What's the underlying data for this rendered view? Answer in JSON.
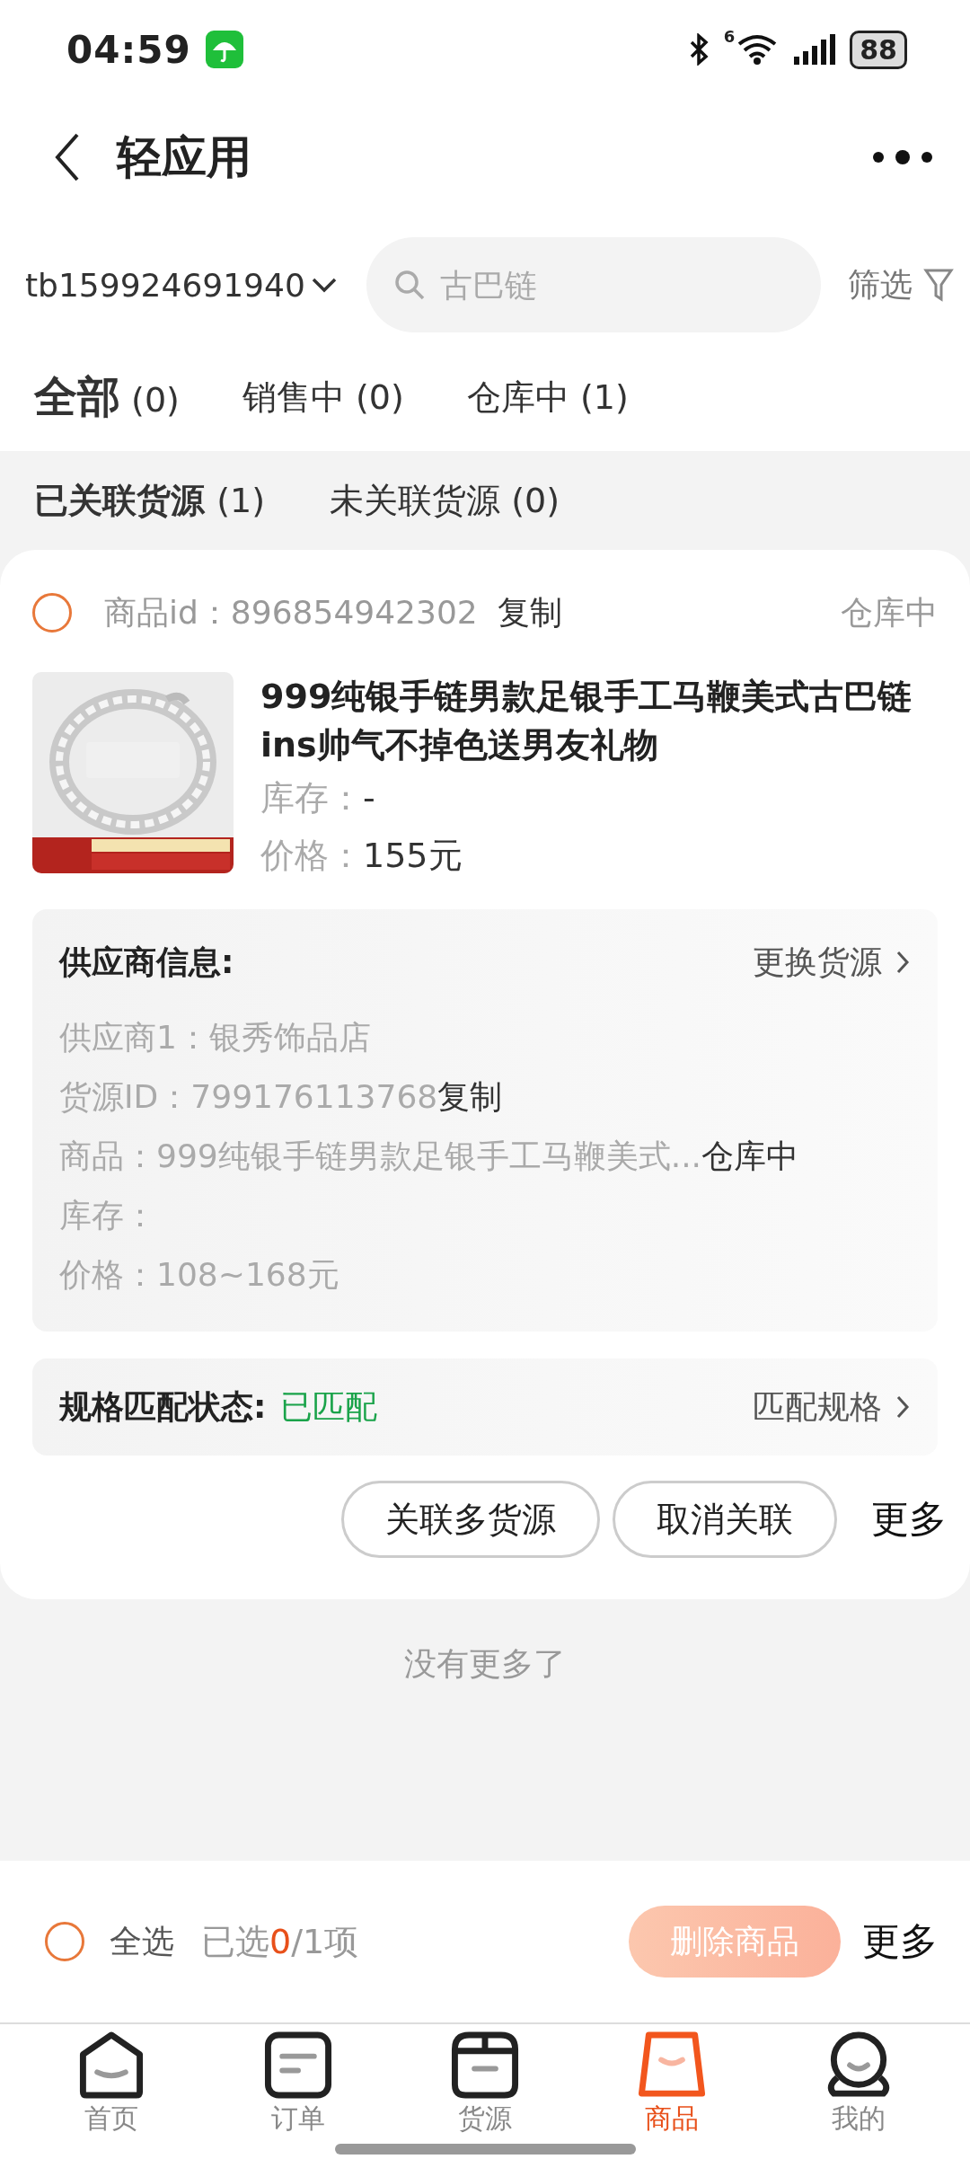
{
  "status_bar": {
    "time": "04:59",
    "battery": "88",
    "network": "6"
  },
  "header": {
    "title": "轻应用"
  },
  "account": {
    "name": "tb159924691940"
  },
  "search": {
    "placeholder": "古巴链"
  },
  "filter": {
    "label": "筛选"
  },
  "tabs": [
    {
      "label": "全部",
      "count": "(0)",
      "selected": true
    },
    {
      "label": "销售中",
      "count": "(0)",
      "selected": false
    },
    {
      "label": "仓库中",
      "count": "(1)",
      "selected": false
    }
  ],
  "sub_tabs": [
    {
      "label": "已关联货源",
      "count": "(1)",
      "selected": true
    },
    {
      "label": "未关联货源",
      "count": "(0)",
      "selected": false
    }
  ],
  "products": [
    {
      "checked": false,
      "id_label": "商品id：",
      "id": "896854942302",
      "copy": "复制",
      "status": "仓库中",
      "image": {
        "kind": "picture"
      },
      "title": "999纯银手链男款足银手工马鞭美式古巴链ins帅气不掉色送男友礼物",
      "stock_label": "库存：",
      "stock": "-",
      "price_label": "价格：",
      "price": "155元",
      "supplier": {
        "heading": "供应商信息:",
        "change": "更换货源",
        "lines": [
          {
            "text": "供应商1：银秀饰品店"
          },
          {
            "text": "货源ID：799176113768",
            "action": "复制"
          },
          {
            "text": "商品：999纯银手链男款足银手工马鞭美式...",
            "action": "仓库中"
          },
          {
            "text": "库存："
          },
          {
            "text": "价格：108~168元"
          }
        ]
      },
      "spec": {
        "label": "规格匹配状态:",
        "value": "已匹配",
        "action": "匹配规格"
      },
      "actions": [
        "关联多货源",
        "取消关联"
      ],
      "more": "更多"
    }
  ],
  "end_note": "没有更多了",
  "footer": {
    "select_all": {
      "label": "全选",
      "checked": false
    },
    "selected_prefix": "已选",
    "selected_count": "0",
    "selected_total": "/1项",
    "delete_button": {
      "label": "删除商品",
      "disabled": true
    },
    "more": "更多"
  },
  "nav": [
    {
      "kind": "home",
      "label": "首页",
      "selected": false
    },
    {
      "kind": "orders",
      "label": "订单",
      "selected": false
    },
    {
      "kind": "box",
      "label": "货源",
      "selected": false
    },
    {
      "kind": "bag",
      "label": "商品",
      "selected": true
    },
    {
      "kind": "me",
      "label": "我的",
      "selected": false
    }
  ]
}
